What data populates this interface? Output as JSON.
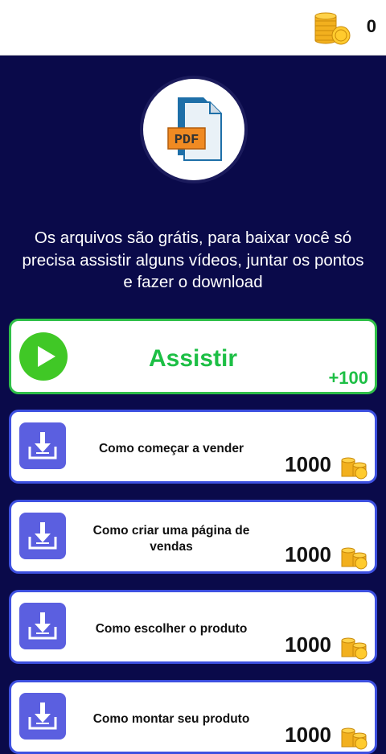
{
  "header": {
    "coin_count": "0",
    "coins_icon": "coin-stack-icon"
  },
  "logo": {
    "badge_text": "PDF",
    "icon": "pdf-document-icon"
  },
  "intro": {
    "text": "Os arquivos são grátis, para baixar você só precisa assistir alguns vídeos, juntar os pontos e fazer o download"
  },
  "watch": {
    "label": "Assistir",
    "bonus": "+100",
    "icon": "play-icon"
  },
  "items": [
    {
      "title": "Como começar a vender",
      "cost": "1000"
    },
    {
      "title": "Como criar uma página de vendas",
      "cost": "1000"
    },
    {
      "title": "Como escolher o produto",
      "cost": "1000"
    },
    {
      "title": "Como montar seu produto",
      "cost": "1000"
    }
  ],
  "colors": {
    "background": "#0a0a4a",
    "accent_green": "#1dbf45",
    "item_border": "#3d50e0",
    "download_icon_bg": "#5b5fe0"
  }
}
